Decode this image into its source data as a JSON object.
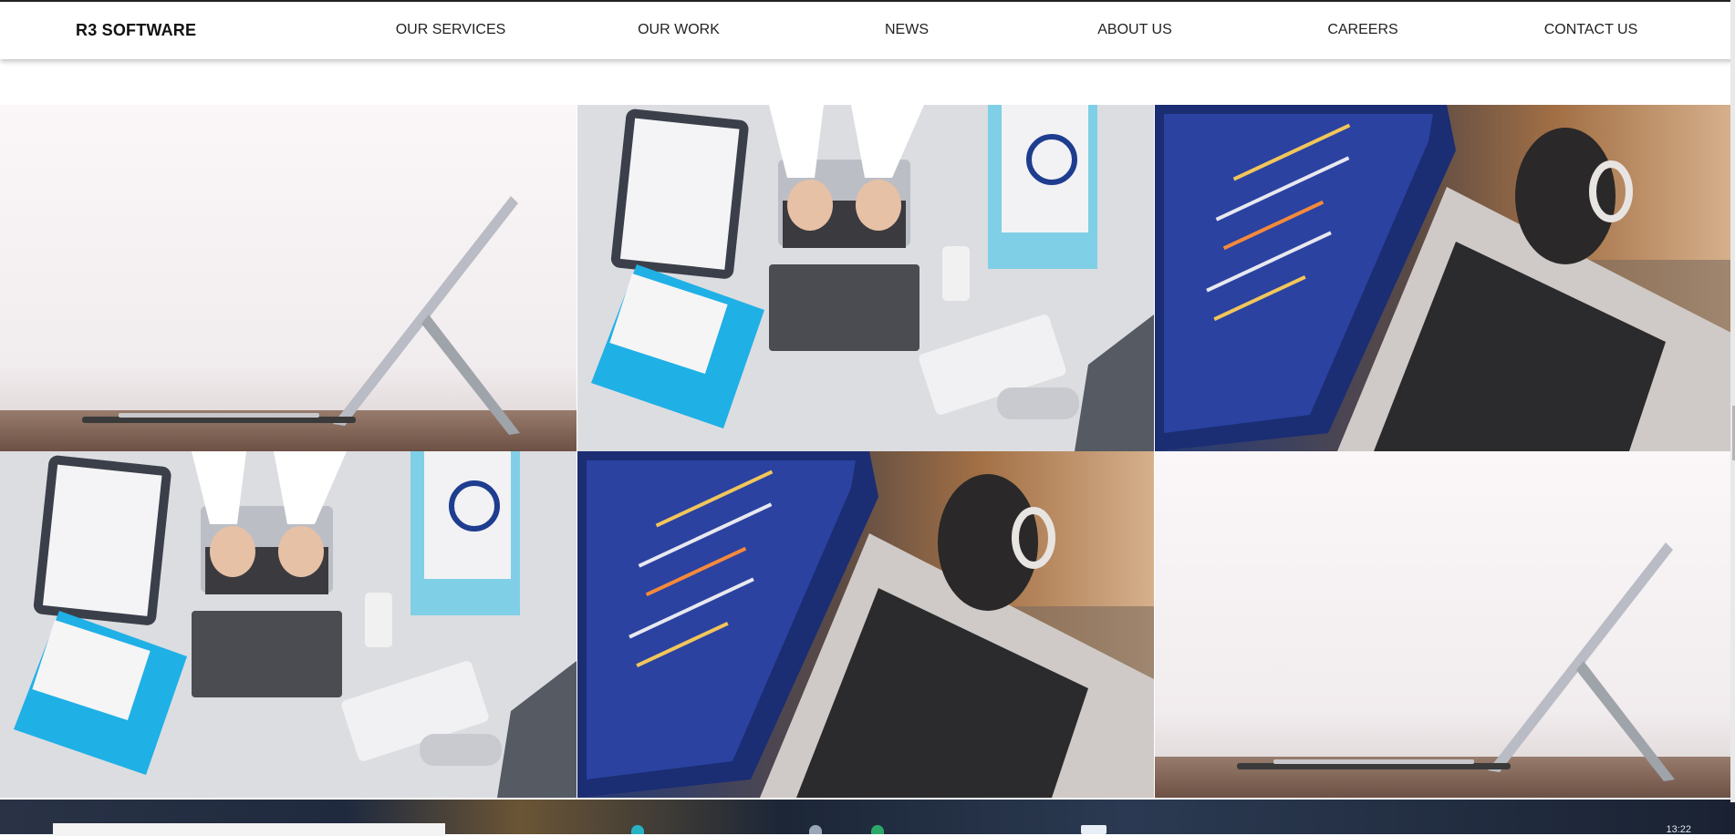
{
  "header": {
    "brand": "R3 SOFTWARE",
    "nav": [
      {
        "label": "OUR SERVICES"
      },
      {
        "label": "OUR WORK"
      },
      {
        "label": "NEWS"
      },
      {
        "label": "ABOUT US"
      },
      {
        "label": "CAREERS"
      },
      {
        "label": "CONTACT US"
      }
    ]
  },
  "gallery": {
    "tiles": [
      {
        "subject": "tablet-on-desk"
      },
      {
        "subject": "doctor-laptop-desk"
      },
      {
        "subject": "laptop-code"
      },
      {
        "subject": "doctor-laptop-desk"
      },
      {
        "subject": "laptop-code"
      },
      {
        "subject": "tablet-on-desk"
      }
    ]
  },
  "taskbar": {
    "clock": "13:22"
  },
  "colors": {
    "nav_text": "#222222",
    "header_bg": "#ffffff",
    "accent_blue": "#1fb0e6"
  }
}
